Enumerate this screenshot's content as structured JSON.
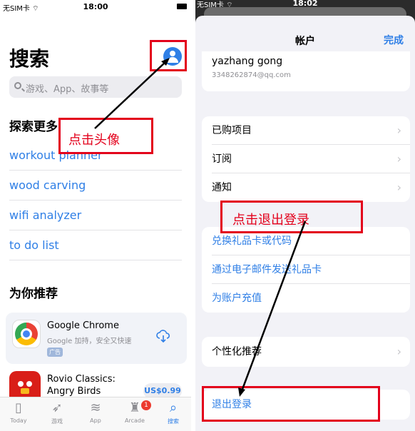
{
  "left": {
    "status": {
      "carrier": "无SIM卡 ⌔",
      "time": "18:00"
    },
    "title": "搜索",
    "search_placeholder": "游戏、App、故事等",
    "explore_title": "探索更多",
    "suggestions": [
      "workout planner",
      "wood carving",
      "wifi analyzer",
      "to do list"
    ],
    "recommend_title": "为你推荐",
    "featured_app": {
      "name": "Google Chrome",
      "subtitle": "Google 加持，安全又快速",
      "badge": "广告"
    },
    "second_app": {
      "name": "Rovio Classics: Angry Birds",
      "price": "US$0.99"
    },
    "tabs": [
      {
        "label": "Today",
        "icon": "today-icon"
      },
      {
        "label": "游戏",
        "icon": "rocket-icon"
      },
      {
        "label": "App",
        "icon": "layers-icon"
      },
      {
        "label": "Arcade",
        "icon": "joystick-icon"
      },
      {
        "label": "搜索",
        "icon": "search-icon"
      }
    ],
    "arcade_badge": "1",
    "annotation": "点击头像"
  },
  "right": {
    "status": {
      "carrier": "无SIM卡 ⌔",
      "time": "18:02"
    },
    "header_title": "帐户",
    "done_label": "完成",
    "account": {
      "name": "yazhang gong",
      "email": "3348262874@qq.com"
    },
    "menu_group": [
      "已购项目",
      "订阅",
      "通知"
    ],
    "gift_group": [
      "兑换礼品卡或代码",
      "通过电子邮件发送礼品卡",
      "为账户充值"
    ],
    "personalized": "个性化推荐",
    "sign_out": "退出登录",
    "annotation": "点击退出登录"
  },
  "colors": {
    "accent": "#2f7fe6",
    "annotation": "#e3001b"
  }
}
